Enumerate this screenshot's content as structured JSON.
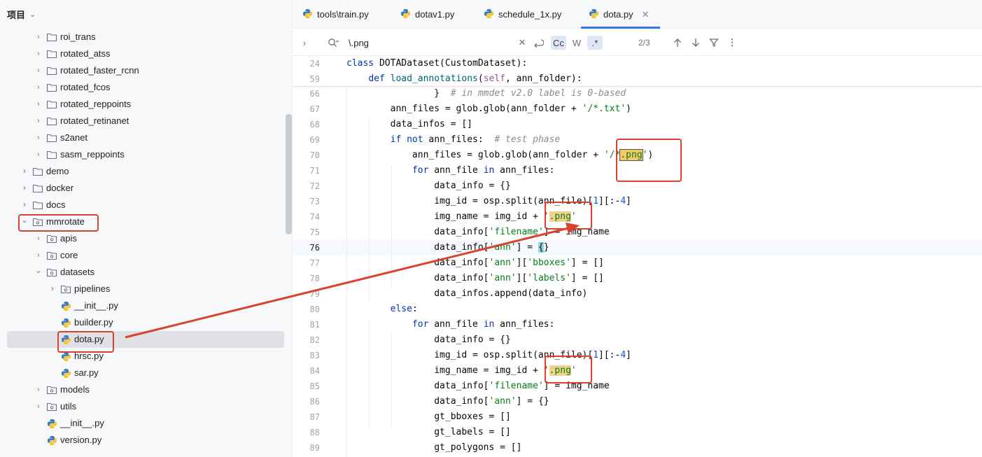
{
  "project": {
    "title": "项目",
    "tree": [
      {
        "label": "roi_trans",
        "type": "folder",
        "depth": 2,
        "expanded": false
      },
      {
        "label": "rotated_atss",
        "type": "folder",
        "depth": 2,
        "expanded": false
      },
      {
        "label": "rotated_faster_rcnn",
        "type": "folder",
        "depth": 2,
        "expanded": false
      },
      {
        "label": "rotated_fcos",
        "type": "folder",
        "depth": 2,
        "expanded": false
      },
      {
        "label": "rotated_reppoints",
        "type": "folder",
        "depth": 2,
        "expanded": false
      },
      {
        "label": "rotated_retinanet",
        "type": "folder",
        "depth": 2,
        "expanded": false
      },
      {
        "label": "s2anet",
        "type": "folder",
        "depth": 2,
        "expanded": false
      },
      {
        "label": "sasm_reppoints",
        "type": "folder",
        "depth": 2,
        "expanded": false
      },
      {
        "label": "demo",
        "type": "folder",
        "depth": 1,
        "expanded": false
      },
      {
        "label": "docker",
        "type": "folder",
        "depth": 1,
        "expanded": false
      },
      {
        "label": "docs",
        "type": "folder",
        "depth": 1,
        "expanded": false
      },
      {
        "label": "mmrotate",
        "type": "package",
        "depth": 1,
        "expanded": true,
        "highlight": true
      },
      {
        "label": "apis",
        "type": "package",
        "depth": 2,
        "expanded": false
      },
      {
        "label": "core",
        "type": "package",
        "depth": 2,
        "expanded": false
      },
      {
        "label": "datasets",
        "type": "package",
        "depth": 2,
        "expanded": true
      },
      {
        "label": "pipelines",
        "type": "package",
        "depth": 3,
        "expanded": false
      },
      {
        "label": "__init__.py",
        "type": "python",
        "depth": 3
      },
      {
        "label": "builder.py",
        "type": "python",
        "depth": 3
      },
      {
        "label": "dota.py",
        "type": "python",
        "depth": 3,
        "selected": true,
        "highlight": true
      },
      {
        "label": "hrsc.py",
        "type": "python",
        "depth": 3
      },
      {
        "label": "sar.py",
        "type": "python",
        "depth": 3
      },
      {
        "label": "models",
        "type": "package",
        "depth": 2,
        "expanded": false
      },
      {
        "label": "utils",
        "type": "package",
        "depth": 2,
        "expanded": false
      },
      {
        "label": "__init__.py",
        "type": "python",
        "depth": 2
      },
      {
        "label": "version.py",
        "type": "python",
        "depth": 2
      }
    ]
  },
  "tabs": [
    {
      "label": "tools\\train.py",
      "active": false
    },
    {
      "label": "dotav1.py",
      "active": false
    },
    {
      "label": "schedule_1x.py",
      "active": false
    },
    {
      "label": "dota.py",
      "active": true
    }
  ],
  "find": {
    "query": "\\.png",
    "match_case": "Cc",
    "words": "W",
    "regex": ".*",
    "result": "2/3"
  },
  "colors": {
    "accent": "#3574f0",
    "annotation_red": "#d9432e",
    "search_hit": "#f2d28b"
  },
  "icons": {
    "python": "python-file-icon",
    "folder": "folder-icon",
    "package": "package-folder-icon"
  },
  "editor": {
    "sticky": [
      {
        "n": "24",
        "code": "class DOTADataset(CustomDataset):"
      },
      {
        "n": "59",
        "code": "    def load_annotations(self, ann_folder):"
      }
    ],
    "lines": [
      {
        "n": "66",
        "code": "                }  # in mmdet v2.0 label is 0-based"
      },
      {
        "n": "67",
        "code": "        ann_files = glob.glob(ann_folder + '/*.txt')"
      },
      {
        "n": "68",
        "code": "        data_infos = []"
      },
      {
        "n": "69",
        "code": "        if not ann_files:  # test phase"
      },
      {
        "n": "70",
        "code": "            ann_files = glob.glob(ann_folder + '/*.png')"
      },
      {
        "n": "71",
        "code": "            for ann_file in ann_files:"
      },
      {
        "n": "72",
        "code": "                data_info = {}"
      },
      {
        "n": "73",
        "code": "                img_id = osp.split(ann_file)[1][:-4]"
      },
      {
        "n": "74",
        "code": "                img_name = img_id + '.png'"
      },
      {
        "n": "75",
        "code": "                data_info['filename'] = img_name"
      },
      {
        "n": "76",
        "code": "                data_info['ann'] = {}"
      },
      {
        "n": "77",
        "code": "                data_info['ann']['bboxes'] = []"
      },
      {
        "n": "78",
        "code": "                data_info['ann']['labels'] = []"
      },
      {
        "n": "79",
        "code": "                data_infos.append(data_info)"
      },
      {
        "n": "80",
        "code": "        else:"
      },
      {
        "n": "81",
        "code": "            for ann_file in ann_files:"
      },
      {
        "n": "82",
        "code": "                data_info = {}"
      },
      {
        "n": "83",
        "code": "                img_id = osp.split(ann_file)[1][:-4]"
      },
      {
        "n": "84",
        "code": "                img_name = img_id + '.png'"
      },
      {
        "n": "85",
        "code": "                data_info['filename'] = img_name"
      },
      {
        "n": "86",
        "code": "                data_info['ann'] = {}"
      },
      {
        "n": "87",
        "code": "                gt_bboxes = []"
      },
      {
        "n": "88",
        "code": "                gt_labels = []"
      },
      {
        "n": "89",
        "code": "                gt_polygons = []"
      }
    ],
    "current_line": "76"
  }
}
